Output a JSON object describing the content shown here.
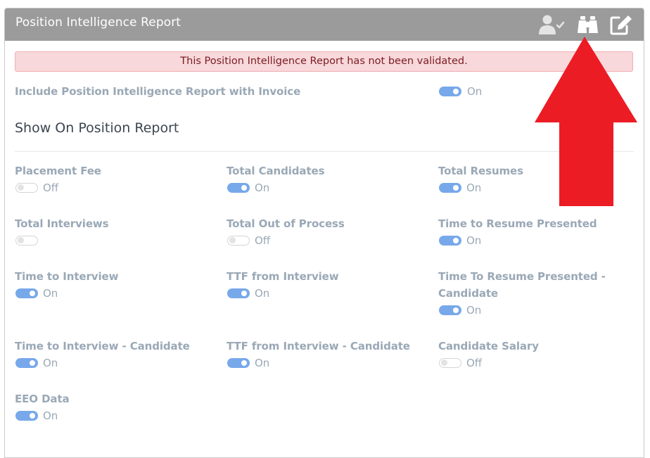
{
  "header": {
    "title": "Position Intelligence Report",
    "icons": [
      "user-check-icon",
      "binoculars-icon",
      "edit-icon"
    ]
  },
  "alert": {
    "text": "This Position Intelligence Report has not been validated."
  },
  "include_invoice": {
    "label": "Include Position Intelligence Report with Invoice",
    "state": "On",
    "enabled": true
  },
  "section": {
    "title": "Show On Position Report"
  },
  "fields": [
    {
      "label": "Placement Fee",
      "state": "Off",
      "enabled": false
    },
    {
      "label": "Total Candidates",
      "state": "On",
      "enabled": true
    },
    {
      "label": "Total Resumes",
      "state": "On",
      "enabled": true
    },
    {
      "label": "Total Interviews",
      "state": "",
      "enabled": false
    },
    {
      "label": "Total Out of Process",
      "state": "Off",
      "enabled": false
    },
    {
      "label": "Time to Resume Presented",
      "state": "On",
      "enabled": true
    },
    {
      "label": "Time to Interview",
      "state": "On",
      "enabled": true
    },
    {
      "label": "TTF from Interview",
      "state": "On",
      "enabled": true
    },
    {
      "label": "Time To Resume Presented -",
      "label_line2": "Candidate",
      "state": "On",
      "enabled": true
    },
    {
      "label": "Time to Interview - Candidate",
      "state": "On",
      "enabled": true
    },
    {
      "label": "TTF from Interview - Candidate",
      "state": "On",
      "enabled": true
    },
    {
      "label": "Candidate Salary",
      "state": "Off",
      "enabled": false
    },
    {
      "label": "EEO Data",
      "state": "On",
      "enabled": true
    }
  ],
  "colors": {
    "header_bg": "#9b9b9b",
    "toggle_on": "#77a8ea",
    "label": "#9aa8b6",
    "alert_bg": "#f8d8da",
    "arrow": "#ec1c24"
  }
}
